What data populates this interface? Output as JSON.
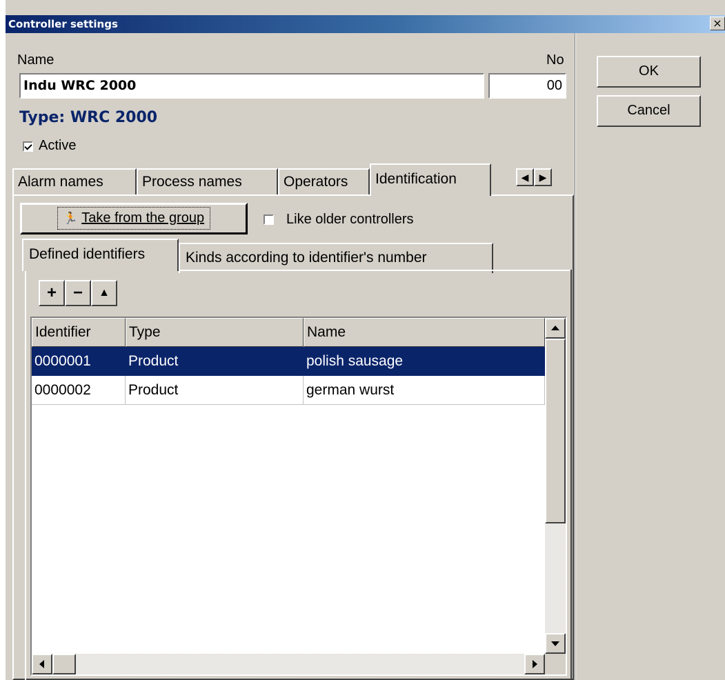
{
  "window": {
    "title": "Controller settings"
  },
  "form": {
    "name_label": "Name",
    "name_value": "Indu WRC 2000",
    "no_label": "No",
    "no_value": "00",
    "type_text": "Type: WRC 2000",
    "active_label": "Active",
    "active_checked": true
  },
  "buttons": {
    "ok": "OK",
    "cancel": "Cancel"
  },
  "tabs": [
    {
      "label": "Alarm names"
    },
    {
      "label": "Process names"
    },
    {
      "label": "Operators"
    },
    {
      "label": "Identification",
      "active": true
    }
  ],
  "identification": {
    "take_button": "Take from the group",
    "like_older_label": "Like older controllers",
    "like_older_checked": false,
    "subtabs": [
      {
        "label": "Defined identifiers",
        "active": true
      },
      {
        "label": "Kinds according to identifier's number"
      }
    ],
    "toolbar": {
      "add": "+",
      "remove": "−",
      "up": "▲"
    },
    "grid": {
      "columns": [
        "Identifier",
        "Type",
        "Name"
      ],
      "rows": [
        {
          "identifier": "0000001",
          "type": "Product",
          "name": "polish sausage",
          "selected": true
        },
        {
          "identifier": "0000002",
          "type": "Product",
          "name": "german wurst",
          "selected": false
        }
      ]
    }
  },
  "colors": {
    "title_start": "#0a246a",
    "title_end": "#a6caf0",
    "face": "#d4d0c8",
    "type_text": "#0a246a",
    "selection": "#0a246a"
  }
}
